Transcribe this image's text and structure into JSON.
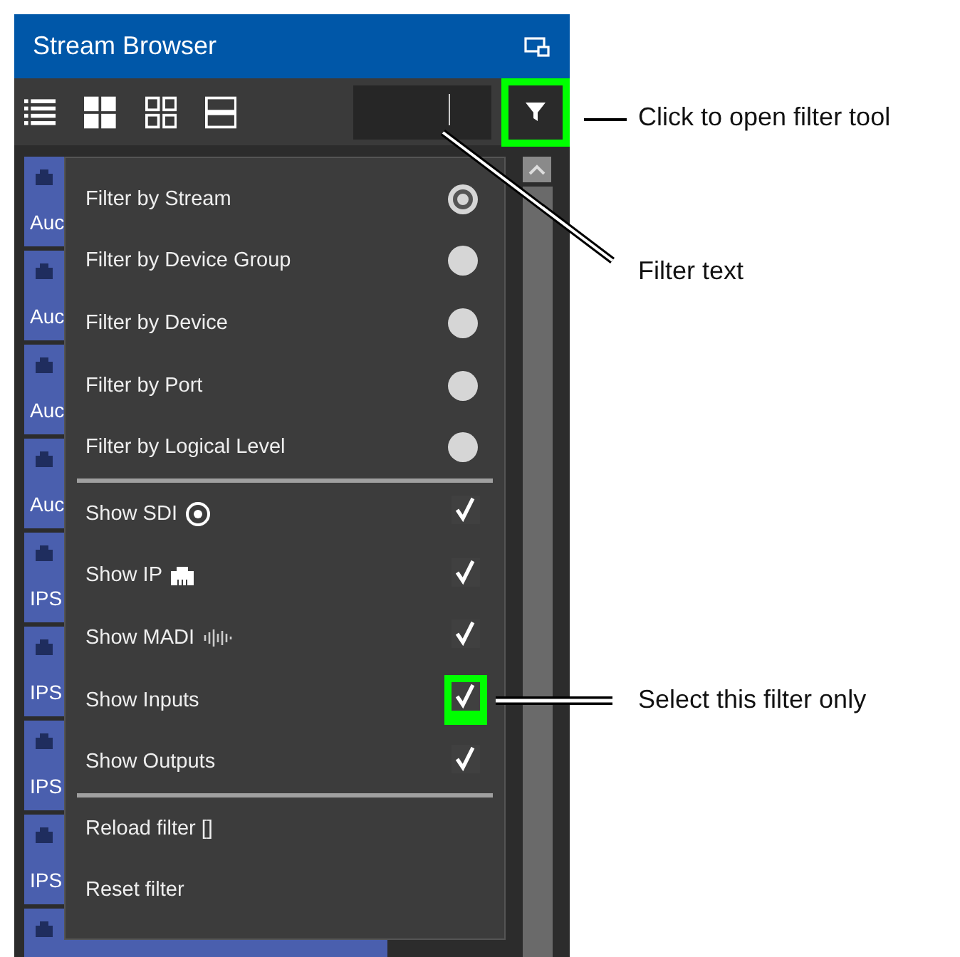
{
  "window": {
    "title": "Stream Browser"
  },
  "toolbar": {
    "filter_button": {
      "highlighted": true
    }
  },
  "tiles": [
    {
      "kind": "covered",
      "label": "Auc"
    },
    {
      "kind": "covered",
      "label": "Auc"
    },
    {
      "kind": "covered",
      "label": "Auc"
    },
    {
      "kind": "covered",
      "label": "Auc"
    },
    {
      "kind": "covered",
      "label": "IPS"
    },
    {
      "kind": "covered",
      "label": "IPS"
    },
    {
      "kind": "covered",
      "label": "IPS"
    },
    {
      "kind": "covered",
      "label": "IPS"
    },
    {
      "kind": "wide"
    }
  ],
  "menu": {
    "sections": [
      {
        "items": [
          {
            "kind": "radio",
            "label": "Filter by Stream",
            "selected": true
          },
          {
            "kind": "radio",
            "label": "Filter by Device Group",
            "selected": false
          },
          {
            "kind": "radio",
            "label": "Filter by Device",
            "selected": false
          },
          {
            "kind": "radio",
            "label": "Filter by Port",
            "selected": false
          },
          {
            "kind": "radio",
            "label": "Filter by Logical Level",
            "selected": false
          }
        ]
      },
      {
        "items": [
          {
            "kind": "check",
            "label": "Show SDI",
            "checked": true,
            "highlighted": false
          },
          {
            "kind": "check",
            "label": "Show IP",
            "checked": true,
            "highlighted": false
          },
          {
            "kind": "check",
            "label": "Show MADI",
            "checked": true,
            "highlighted": false
          },
          {
            "kind": "check",
            "label": "Show Inputs",
            "checked": true,
            "highlighted": true
          },
          {
            "kind": "check",
            "label": "Show Outputs",
            "checked": true,
            "highlighted": false
          }
        ]
      },
      {
        "items": [
          {
            "kind": "action",
            "label": "Reload filter []"
          },
          {
            "kind": "action",
            "label": "Reset filter"
          }
        ]
      }
    ]
  },
  "callouts": [
    {
      "text": "Click to open filter tool"
    },
    {
      "text": "Filter text"
    },
    {
      "text": "Select this filter only"
    }
  ]
}
